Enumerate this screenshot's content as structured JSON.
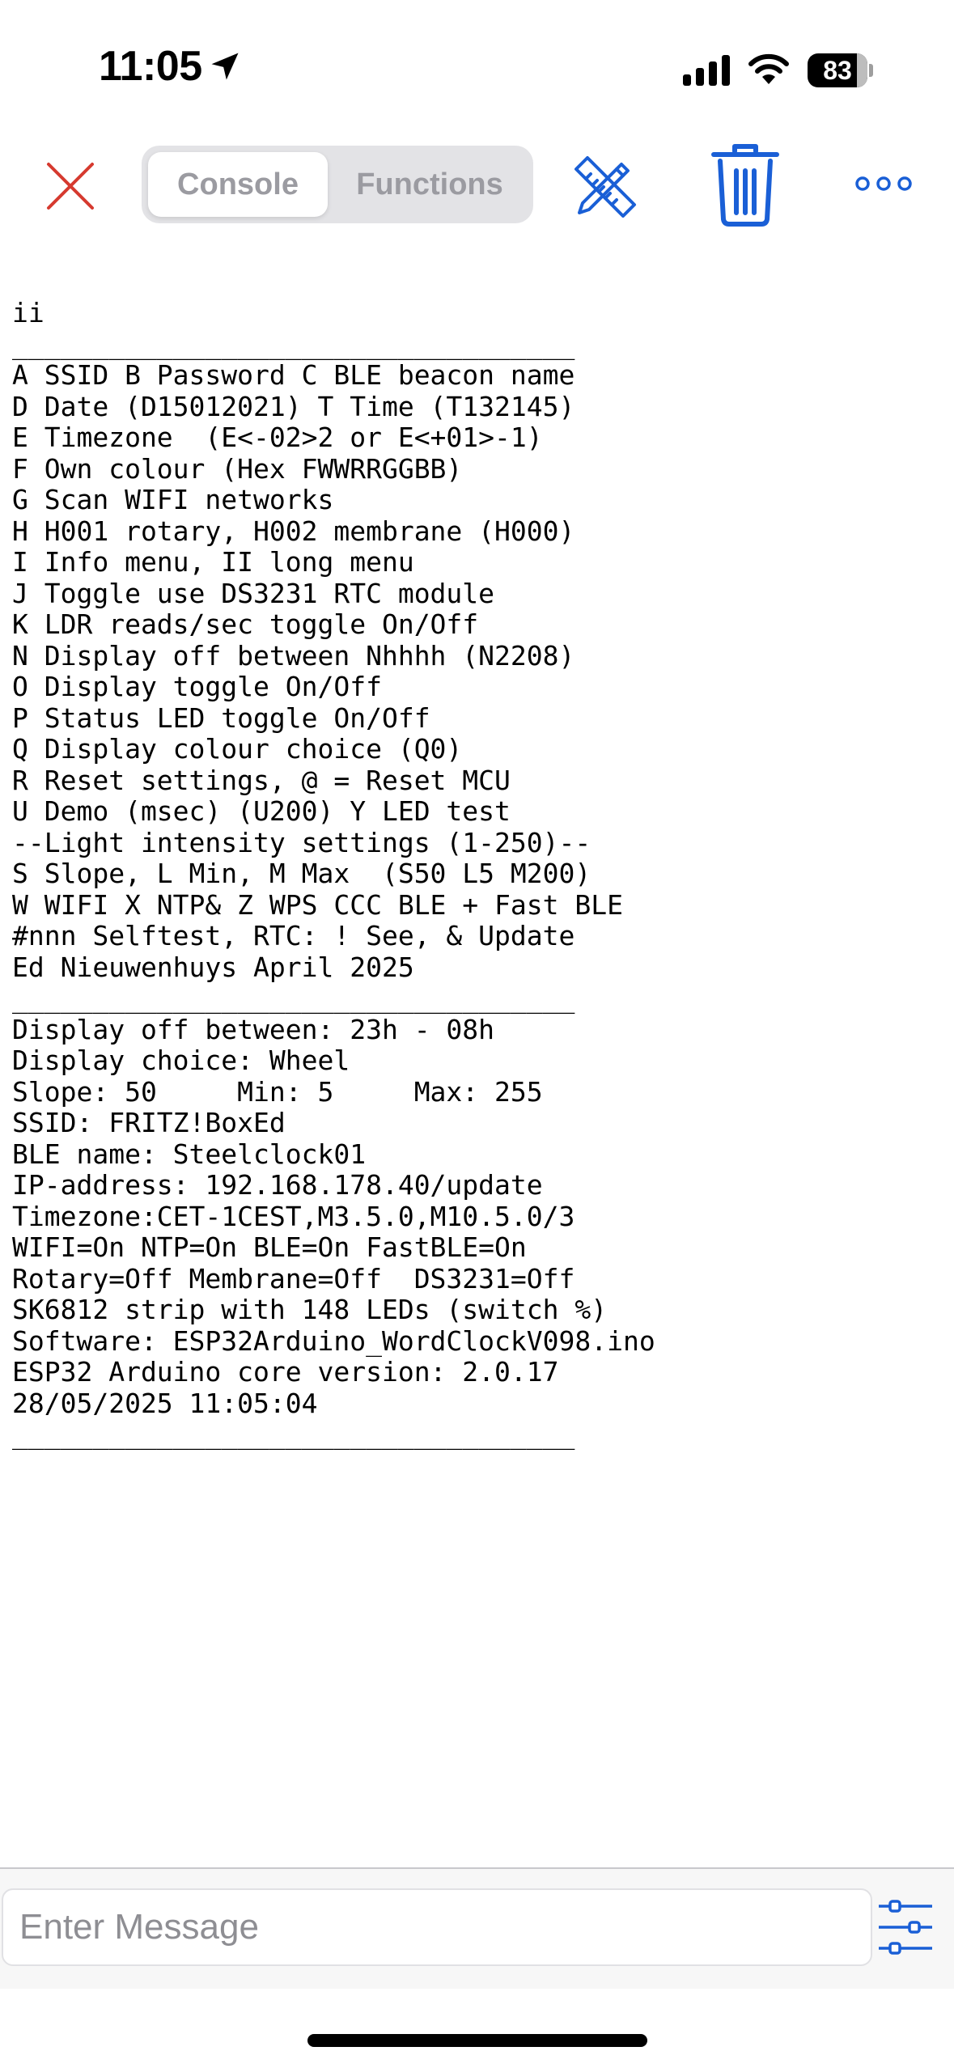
{
  "status_bar": {
    "time": "11:05",
    "battery": "83"
  },
  "toolbar": {
    "tabs": [
      {
        "label": "Console",
        "selected": true
      },
      {
        "label": "Functions",
        "selected": false
      }
    ]
  },
  "console": {
    "lines": [
      "ii",
      "___________________________________",
      "A SSID B Password C BLE beacon name",
      "D Date (D15012021) T Time (T132145)",
      "E Timezone  (E<-02>2 or E<+01>-1)",
      "F Own colour (Hex FWWRRGGBB)",
      "G Scan WIFI networks",
      "H H001 rotary, H002 membrane (H000)",
      "I Info menu, II long menu",
      "J Toggle use DS3231 RTC module",
      "K LDR reads/sec toggle On/Off",
      "N Display off between Nhhhh (N2208)",
      "O Display toggle On/Off",
      "P Status LED toggle On/Off",
      "Q Display colour choice (Q0)",
      "R Reset settings, @ = Reset MCU",
      "U Demo (msec) (U200) Y LED test",
      "--Light intensity settings (1-250)--",
      "S Slope, L Min, M Max  (S50 L5 M200)",
      "W WIFI X NTP& Z WPS CCC BLE + Fast BLE",
      "#nnn Selftest, RTC: ! See, & Update",
      "Ed Nieuwenhuys April 2025",
      "___________________________________",
      "Display off between: 23h - 08h",
      "Display choice: Wheel",
      "Slope: 50     Min: 5     Max: 255",
      "SSID: FRITZ!BoxEd",
      "BLE name: Steelclock01",
      "IP-address: 192.168.178.40/update",
      "Timezone:CET-1CEST,M3.5.0,M10.5.0/3",
      "WIFI=On NTP=On BLE=On FastBLE=On",
      "Rotary=Off Membrane=Off  DS3231=Off",
      "SK6812 strip with 148 LEDs (switch %)",
      "Software: ESP32Arduino_WordClockV098.ino",
      "ESP32 Arduino core version: 2.0.17",
      "28/05/2025 11:05:04",
      "___________________________________"
    ]
  },
  "input": {
    "placeholder": "Enter Message",
    "value": ""
  },
  "icons": {
    "close": "close-icon",
    "ruler_pencil": "ruler-pencil-icon",
    "trash": "trash-icon",
    "more": "more-icon",
    "sliders": "sliders-icon",
    "location": "location-arrow-icon",
    "signal": "cellular-signal-icon",
    "wifi": "wifi-icon"
  },
  "colors": {
    "accent": "#1a5fd6",
    "close": "#d63a2f",
    "segment_text": "#9b9ba1"
  }
}
